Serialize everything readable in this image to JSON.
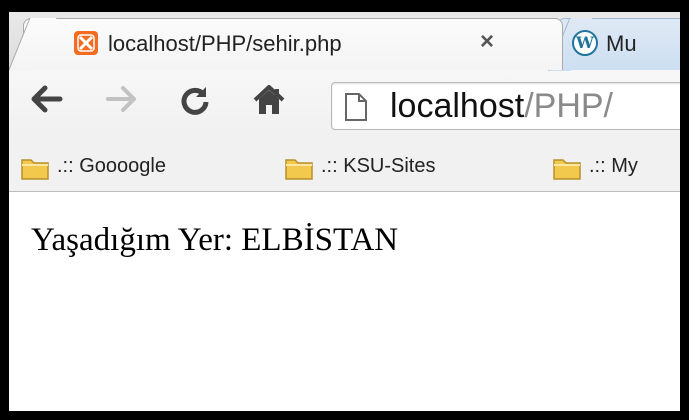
{
  "tabs": [
    {
      "title": "localhost/PHP/sehir.php",
      "icon": "xampp-icon",
      "close": "×",
      "active": true
    },
    {
      "title": "Mu",
      "icon": "wordpress-icon",
      "active": false
    }
  ],
  "toolbar": {
    "back_icon": "arrow-left-icon",
    "forward_icon": "arrow-right-icon",
    "reload_icon": "reload-icon",
    "home_icon": "home-icon"
  },
  "address_bar": {
    "host": "localhost",
    "path": "/PHP/"
  },
  "bookmarks": [
    {
      "label": ".:: Goooogle",
      "icon": "folder-icon"
    },
    {
      "label": ".:: KSU-Sites",
      "icon": "folder-icon"
    },
    {
      "label": ".:: My",
      "icon": "folder-icon"
    }
  ],
  "page": {
    "text": "Yaşadığım Yer: ELBİSTAN"
  },
  "colors": {
    "xampp_orange": "#f36c21",
    "wordpress_blue": "#21759b",
    "folder_yellow": "#f2c94c"
  }
}
